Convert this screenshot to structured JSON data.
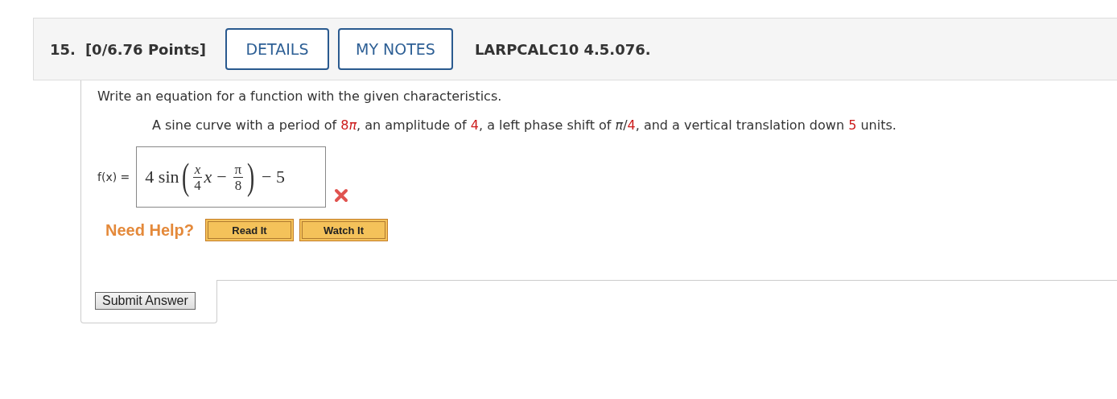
{
  "header": {
    "number": "15.",
    "points": "[0/6.76 Points]",
    "buttons": [
      {
        "label": "DETAILS"
      },
      {
        "label": "MY NOTES"
      }
    ],
    "code": "LARPCALC10 4.5.076."
  },
  "instruction": "Write an equation for a function with the given characteristics.",
  "prompt": [
    {
      "text": "A sine curve with a period of ",
      "highlight": false
    },
    {
      "text": "8",
      "highlight": true
    },
    {
      "text": "*π*",
      "highlight": true
    },
    {
      "text": ", an amplitude of ",
      "highlight": false
    },
    {
      "text": "4",
      "highlight": true
    },
    {
      "text": ", a left phase shift of *π*/",
      "highlight": false
    },
    {
      "text": "4",
      "highlight": true
    },
    {
      "text": ", and a vertical translation down ",
      "highlight": false
    },
    {
      "text": "5",
      "highlight": true
    },
    {
      "text": " units.",
      "highlight": false
    }
  ],
  "answer": {
    "label": "f(x) =",
    "coefficient": "4",
    "function": "sin",
    "frac1": {
      "num": "x",
      "den": "4"
    },
    "open": "(",
    "close": ")",
    "variable": "x",
    "operator": "−",
    "frac2": {
      "num": "π",
      "den": "8"
    },
    "tail": "− 5",
    "correct": false
  },
  "help": {
    "label": "Need Help?",
    "buttons": [
      {
        "label": "Read It"
      },
      {
        "label": "Watch It"
      }
    ]
  },
  "submit": "Submit Answer"
}
